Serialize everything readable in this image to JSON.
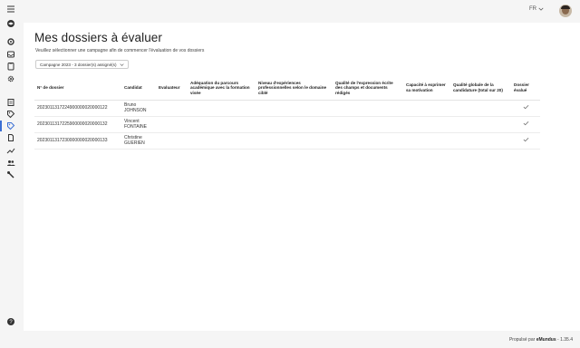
{
  "header": {
    "language": "FR"
  },
  "page": {
    "title": "Mes dossiers à évaluer",
    "subtitle": "Veuillez sélectionner une campagne afin de commencer l'évaluation de vos dossiers",
    "campaign_select": "Campagne 2023 - 3 dossier(s) assigné(s)"
  },
  "table": {
    "headers": [
      "N° de dossier",
      "Candidat",
      "Evaluateur",
      "Adéquation du parcours académique avec la formation visée",
      "Niveau d'expériences professionnelles selon le domaine ciblé",
      "Qualité de l'expression écrite des champs et documents rédigés",
      "Capacité à exprimer sa motivation",
      "Qualité globale de la candidature (total sur 20)",
      "Dossier évalué"
    ],
    "rows": [
      {
        "file": "2023011317224900000020000122",
        "candidate": "Bruno JOHNSON",
        "evaluator": "",
        "c1": "",
        "c2": "",
        "c3": "",
        "c4": "",
        "c5": "",
        "evaluated": true
      },
      {
        "file": "2023011317225900000020000132",
        "candidate": "Vincent FONTAINE",
        "evaluator": "",
        "c1": "",
        "c2": "",
        "c3": "",
        "c4": "",
        "c5": "",
        "evaluated": true
      },
      {
        "file": "2023011317230000000020000133",
        "candidate": "Christine GUERIEN",
        "evaluator": "",
        "c1": "",
        "c2": "",
        "c3": "",
        "c4": "",
        "c5": "",
        "evaluated": true
      }
    ]
  },
  "footer": {
    "prefix": "Propulsé par",
    "brand": "eMundus",
    "version": "- 1.35.4"
  },
  "icons": {
    "sidebar": [
      "menu-icon",
      "graduation-cap-icon",
      "gear-icon",
      "inbox-icon",
      "clipboard-icon",
      "settings-icon",
      "document-icon",
      "tag-icon",
      "tag-icon",
      "file-icon",
      "chart-line-icon",
      "users-icon",
      "tools-icon",
      "help-icon"
    ]
  },
  "colors": {
    "accent": "#3b6fd4",
    "background": "#f5f5f5",
    "panel": "#ffffff"
  }
}
